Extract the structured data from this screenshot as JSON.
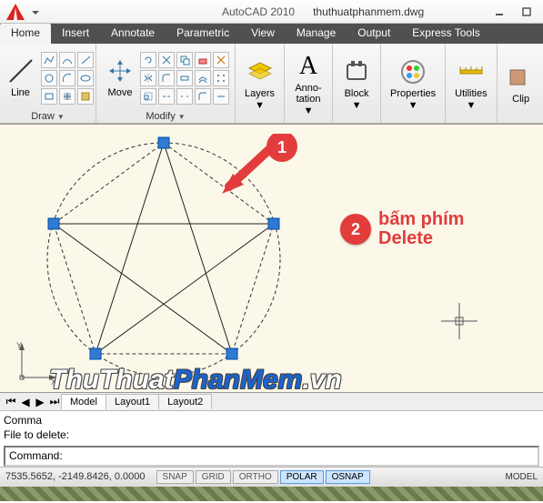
{
  "title": {
    "app": "AutoCAD 2010",
    "file": "thuthuatphanmem.dwg"
  },
  "tabs": {
    "items": [
      {
        "label": "Home"
      },
      {
        "label": "Insert"
      },
      {
        "label": "Annotate"
      },
      {
        "label": "Parametric"
      },
      {
        "label": "View"
      },
      {
        "label": "Manage"
      },
      {
        "label": "Output"
      },
      {
        "label": "Express Tools"
      }
    ],
    "active": 0
  },
  "ribbon": {
    "draw": {
      "label": "Draw",
      "line": "Line"
    },
    "modify": {
      "label": "Modify",
      "move": "Move"
    },
    "layers": {
      "label": "Layers"
    },
    "annotation": {
      "label": "Anno-\ntation",
      "glyph": "A"
    },
    "block": {
      "label": "Block"
    },
    "properties": {
      "label": "Properties"
    },
    "utilities": {
      "label": "Utilities"
    },
    "clip": {
      "label": "Clip"
    }
  },
  "annotations": {
    "n1": "1",
    "n2": "2",
    "text2": "bấm phím\nDelete"
  },
  "watermark": {
    "a": "ThuThuat",
    "b": "PhanMem",
    "c": ".vn"
  },
  "layout": {
    "tabs": [
      "Model",
      "Layout1",
      "Layout2"
    ],
    "active": 0
  },
  "cmd": {
    "l1": "Comma",
    "l2": "File to delete:",
    "l3": "",
    "prompt": "Command:"
  },
  "status": {
    "coords": "7535.5652, -2149.8426, 0.0000",
    "model": "MODEL",
    "btns": [
      "SNAP",
      "GRID",
      "ORTHO",
      "POLAR",
      "OSNAP"
    ]
  },
  "colors": {
    "accent": "#e23c3c",
    "grip": "#2e7bd1"
  }
}
